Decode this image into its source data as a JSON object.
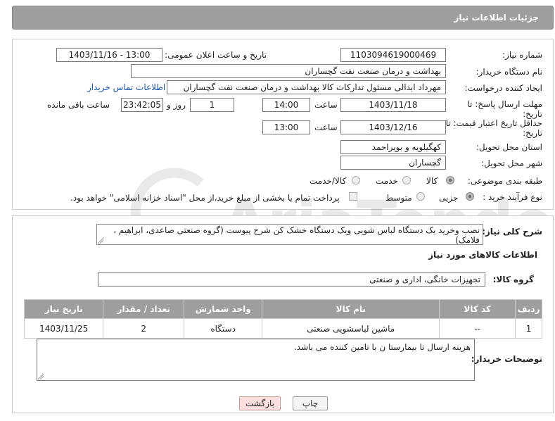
{
  "header": {
    "title": "جزئیات اطلاعات نیاز"
  },
  "form": {
    "need_number_label": "شماره نیاز:",
    "need_number": "1103094619000469",
    "announce_label": "تاریخ و ساعت اعلان عمومی:",
    "announce_value": "1403/11/16 - 13:00",
    "buyer_org_label": "نام دستگاه خریدار:",
    "buyer_org": "بهداشت و درمان صنعت نفت گچساران",
    "creator_label": "ایجاد کننده درخواست:",
    "creator": "مهرداد ابدالی مسئول تدارکات کالا  بهداشت و درمان صنعت نفت گچساران",
    "contact_link": "اطلاعات تماس خریدار",
    "reply_deadline_label": "مهلت ارسال پاسخ: تا تاریخ:",
    "reply_date": "1403/11/18",
    "time_label": "ساعت",
    "reply_time": "14:00",
    "days_value": "1",
    "days_label": "روز و",
    "remaining_time": "23:42:05",
    "remaining_label": "ساعت باقی مانده",
    "price_validity_label": "حداقل تاریخ اعتبار قیمت: تا تاریخ:",
    "price_date": "1403/12/16",
    "time_label2": "ساعت",
    "price_time": "13:00",
    "province_label": "استان محل تحویل:",
    "province": "کهگیلویه و بویراحمد",
    "city_label": "شهر محل تحویل:",
    "city": "گچساران",
    "category_label": "طبقه بندی موضوعی:",
    "category_options": [
      "کالا",
      "خدمت",
      "کالا/خدمت"
    ],
    "category_selected": "کالا",
    "process_label": "نوع فرآیند خرید :",
    "process_options": [
      "جزیی",
      "متوسط"
    ],
    "process_selected": "جزیی",
    "payment_note": "پرداخت تمام یا بخشی از مبلغ خرید،از محل \"اسناد خزانه اسلامی\" خواهد بود."
  },
  "description": {
    "label": "شرح کلی نیاز:",
    "text": "نصب وخرید یک دستگاه لباس شویی ویک دستگاه خشک کن شرح پیوست  (گروه صنعتی صاعدی، ابراهیم ، فلامک)"
  },
  "goods": {
    "section_title": "اطلاعات کالاهای مورد نیاز",
    "group_label": "گروه کالا:",
    "group_value": "تجهیزات خانگی، اداری و صنعتی",
    "columns": [
      "ردیف",
      "کد کالا",
      "نام کالا",
      "واحد شمارش",
      "تعداد / مقدار",
      "تاریخ نیاز"
    ],
    "rows": [
      [
        "1",
        "--",
        "ماشین لباسشویی صنعتی",
        "دستگاه",
        "2",
        "1403/11/25"
      ]
    ]
  },
  "buyer_notes": {
    "label": "توضیحات خریدار:",
    "text": "هزینه ارسال تا بیمارستا ن با تامین کننده می باشد."
  },
  "buttons": {
    "print": "چاپ",
    "back": "بازگشت"
  },
  "watermark": {
    "text": "AriaTender.net"
  },
  "colors": {
    "header_bg": "#9e9e9e",
    "link": "#1a55b5",
    "back_bg": "#fbdede"
  }
}
